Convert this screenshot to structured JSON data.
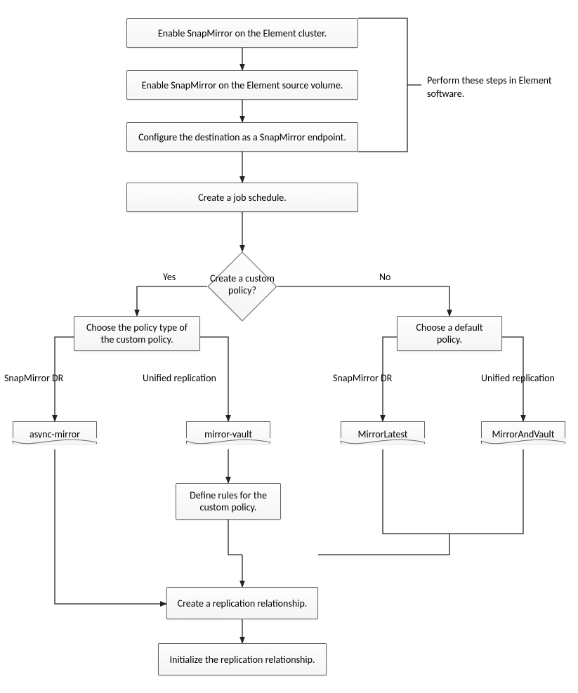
{
  "chart_data": {
    "type": "flowchart",
    "nodes": [
      {
        "id": "n1",
        "type": "process",
        "text": "Enable SnapMirror on the Element cluster."
      },
      {
        "id": "n2",
        "type": "process",
        "text": "Enable SnapMirror on the Element source volume."
      },
      {
        "id": "n3",
        "type": "process",
        "text": "Configure the destination as a SnapMirror endpoint."
      },
      {
        "id": "n4",
        "type": "process",
        "text": "Create a job schedule."
      },
      {
        "id": "d1",
        "type": "decision",
        "text": "Create a custom policy?"
      },
      {
        "id": "n5",
        "type": "process",
        "text": "Choose the policy type of the custom policy."
      },
      {
        "id": "n6",
        "type": "process",
        "text": "Choose a default policy."
      },
      {
        "id": "doc1",
        "type": "document",
        "text": "async-mirror"
      },
      {
        "id": "doc2",
        "type": "document",
        "text": "mirror-vault"
      },
      {
        "id": "doc3",
        "type": "document",
        "text": "MirrorLatest"
      },
      {
        "id": "doc4",
        "type": "document",
        "text": "MirrorAndVault"
      },
      {
        "id": "n7",
        "type": "process",
        "text": "Define rules for the custom policy."
      },
      {
        "id": "n8",
        "type": "process",
        "text": "Create a replication relationship."
      },
      {
        "id": "n9",
        "type": "process",
        "text": "Initialize the replication relationship."
      }
    ],
    "edges": [
      {
        "from": "n1",
        "to": "n2"
      },
      {
        "from": "n2",
        "to": "n3"
      },
      {
        "from": "n3",
        "to": "n4"
      },
      {
        "from": "n4",
        "to": "d1"
      },
      {
        "from": "d1",
        "to": "n5",
        "label": "Yes"
      },
      {
        "from": "d1",
        "to": "n6",
        "label": "No"
      },
      {
        "from": "n5",
        "to": "doc1",
        "label": "SnapMirror DR"
      },
      {
        "from": "n5",
        "to": "doc2",
        "label": "Unified replication"
      },
      {
        "from": "n6",
        "to": "doc3",
        "label": "SnapMirror DR"
      },
      {
        "from": "n6",
        "to": "doc4",
        "label": "Unified replication"
      },
      {
        "from": "doc2",
        "to": "n7"
      },
      {
        "from": "doc1",
        "to": "n8"
      },
      {
        "from": "n7",
        "to": "n8"
      },
      {
        "from": "doc3",
        "to": "n8"
      },
      {
        "from": "doc4",
        "to": "n8"
      },
      {
        "from": "n8",
        "to": "n9"
      }
    ],
    "annotations": [
      {
        "text": "Perform these steps in  Element software.",
        "attached_to": [
          "n1",
          "n2",
          "n3"
        ]
      }
    ]
  },
  "steps": {
    "n1": "Enable SnapMirror on the Element cluster.",
    "n2": "Enable SnapMirror on the Element source volume.",
    "n3": "Configure the destination as a SnapMirror endpoint.",
    "n4": "Create a job schedule.",
    "d1": "Create a custom policy?",
    "n5": "Choose the policy type of the custom policy.",
    "n6": "Choose a default policy.",
    "doc1": "async-mirror",
    "doc2": "mirror-vault",
    "doc3": "MirrorLatest",
    "doc4": "MirrorAndVault",
    "n7": "Define rules for the custom policy.",
    "n8": "Create a replication relationship.",
    "n9": "Initialize the replication relationship."
  },
  "labels": {
    "yes": "Yes",
    "no": "No",
    "smdr1": "SnapMirror DR",
    "ur1": "Unified replication",
    "smdr2": "SnapMirror DR",
    "ur2": "Unified replication",
    "annotation": "Perform these steps in  Element software."
  }
}
